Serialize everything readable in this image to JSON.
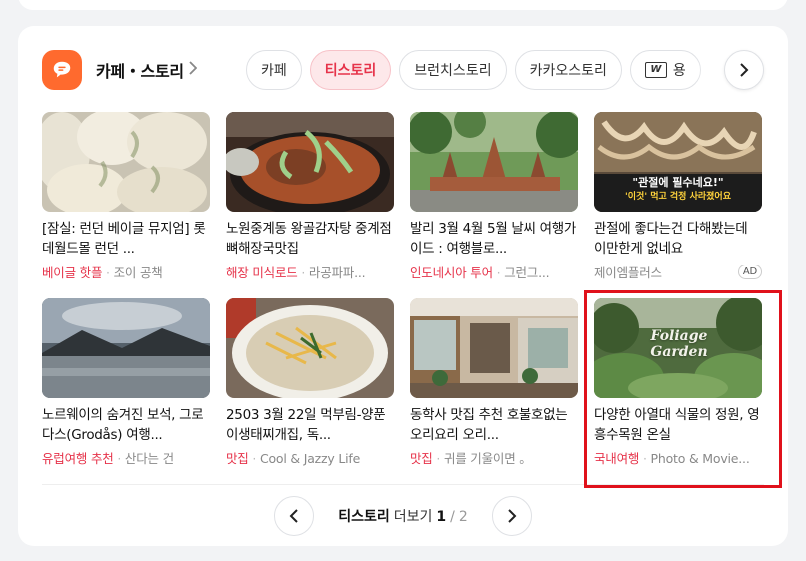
{
  "section": {
    "title": "카페・스토리",
    "icon": "chat-bubble-icon",
    "brand_color": "#ff6a2e",
    "accent_color": "#e6334a"
  },
  "chips": [
    {
      "label": "카페",
      "active": false
    },
    {
      "label": "티스토리",
      "active": true
    },
    {
      "label": "브런치스토리",
      "active": false
    },
    {
      "label": "카카오스토리",
      "active": false
    },
    {
      "label": "용",
      "active": false,
      "icon": "webzine-icon"
    }
  ],
  "items": [
    {
      "title": "[잠실: 런던 베이글 뮤지엄] 롯데월드몰 런던 ...",
      "tag": "베이글 핫플",
      "source": "조이 공책",
      "ad": false,
      "thumb": "bagel-photo"
    },
    {
      "title": "노원중계동 왕골감자탕 중계점 뼈해장국맛집",
      "tag": "해장 미식로드",
      "source": "라공파파...",
      "ad": false,
      "thumb": "pork-bone-stew-photo"
    },
    {
      "title": "발리 3월 4월 5월 날씨 여행가이드 : 여행블로...",
      "tag": "인도네시아 투어",
      "source": "그런그...",
      "ad": false,
      "thumb": "bali-temple-photo"
    },
    {
      "title": "관절에 좋다는건 다해봤는데 이만한게 없네요",
      "tag": "",
      "source": "제이엠플러스",
      "ad": true,
      "ad_label": "AD",
      "thumb_caption_1": "\"관절에 필수네요!\"",
      "thumb_caption_2": "'이것' 먹고 걱정 사라졌어요",
      "thumb": "joint-supplement-ad-photo"
    },
    {
      "title": "노르웨이의 숨겨진 보석, 그로다스(Grodås) 여행...",
      "tag": "유럽여행 추천",
      "source": "산다는 건",
      "ad": false,
      "thumb": "norway-lake-photo"
    },
    {
      "title": "2503 3월 22일 먹부림-양푼이생태찌개집, 독...",
      "tag": "맛집",
      "source": "Cool & Jazzy Life",
      "ad": false,
      "thumb": "noodle-soup-photo"
    },
    {
      "title": "동학사 맛집 추천 호불호없는 오리요리 오리...",
      "tag": "맛집",
      "source": "귀를 기울이면 。",
      "ad": false,
      "thumb": "restaurant-interior-photo"
    },
    {
      "title": "다양한 아열대 식물의 정원, 영흥수목원 온실",
      "tag": "국내여행",
      "source": "Photo & Movie...",
      "ad": false,
      "thumb_caption_1": "Foliage Garden",
      "thumb": "foliage-garden-photo"
    }
  ],
  "pager": {
    "label": "티스토리",
    "more": "더보기",
    "current": "1",
    "separator": "/",
    "total": "2"
  }
}
